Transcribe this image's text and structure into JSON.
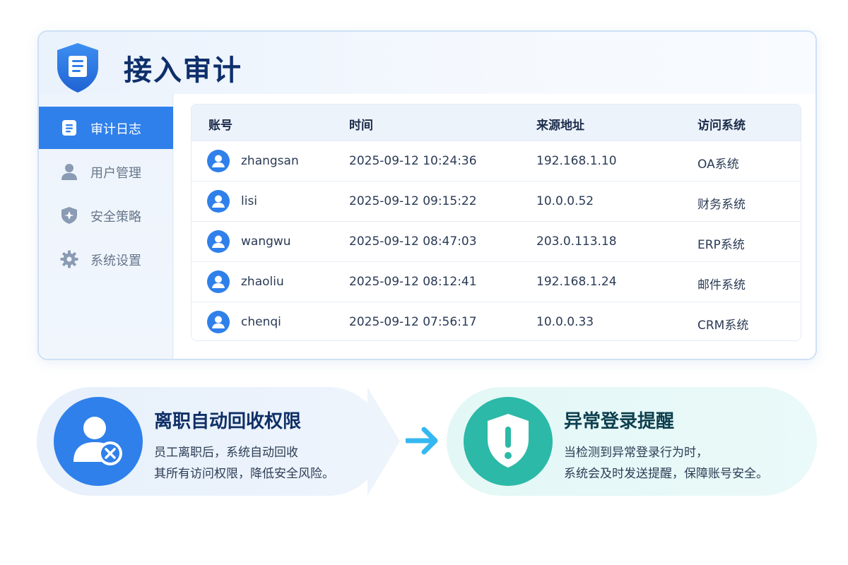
{
  "app": {
    "title": "接入审计"
  },
  "sidebar": {
    "items": [
      {
        "label": "审计日志",
        "icon": "document-icon",
        "active": true
      },
      {
        "label": "用户管理",
        "icon": "user-icon",
        "active": false
      },
      {
        "label": "安全策略",
        "icon": "shield-icon",
        "active": false
      },
      {
        "label": "系统设置",
        "icon": "gear-icon",
        "active": false
      }
    ]
  },
  "table": {
    "columns": [
      "账号",
      "时间",
      "来源地址",
      "访问系统"
    ],
    "rows": [
      {
        "account": "zhangsan",
        "time": "2025-09-12 10:24:36",
        "ip": "192.168.1.10",
        "system": "OA系统"
      },
      {
        "account": "lisi",
        "time": "2025-09-12 09:15:22",
        "ip": "10.0.0.52",
        "system": "财务系统"
      },
      {
        "account": "wangwu",
        "time": "2025-09-12 08:47:03",
        "ip": "203.0.113.18",
        "system": "ERP系统"
      },
      {
        "account": "zhaoliu",
        "time": "2025-09-12 08:12:41",
        "ip": "192.168.1.24",
        "system": "邮件系统"
      },
      {
        "account": "chenqi",
        "time": "2025-09-12 07:56:17",
        "ip": "10.0.0.33",
        "system": "CRM系统"
      }
    ]
  },
  "cards": {
    "offboard": {
      "title": "离职自动回收权限",
      "desc_line1": "员工离职后，系统自动回收",
      "desc_line2": "其所有访问权限，降低安全风险。",
      "icon": "user-remove-icon"
    },
    "alert": {
      "title": "异常登录提醒",
      "desc_line1": "当检测到异常登录行为时，",
      "desc_line2": "系统会及时发送提醒，保障账号安全。",
      "icon": "shield-alert-icon"
    }
  },
  "colors": {
    "primary": "#2f80ea",
    "teal": "#2cb9a7",
    "title": "#0e2f6b",
    "arrow": "#35b8f0"
  }
}
